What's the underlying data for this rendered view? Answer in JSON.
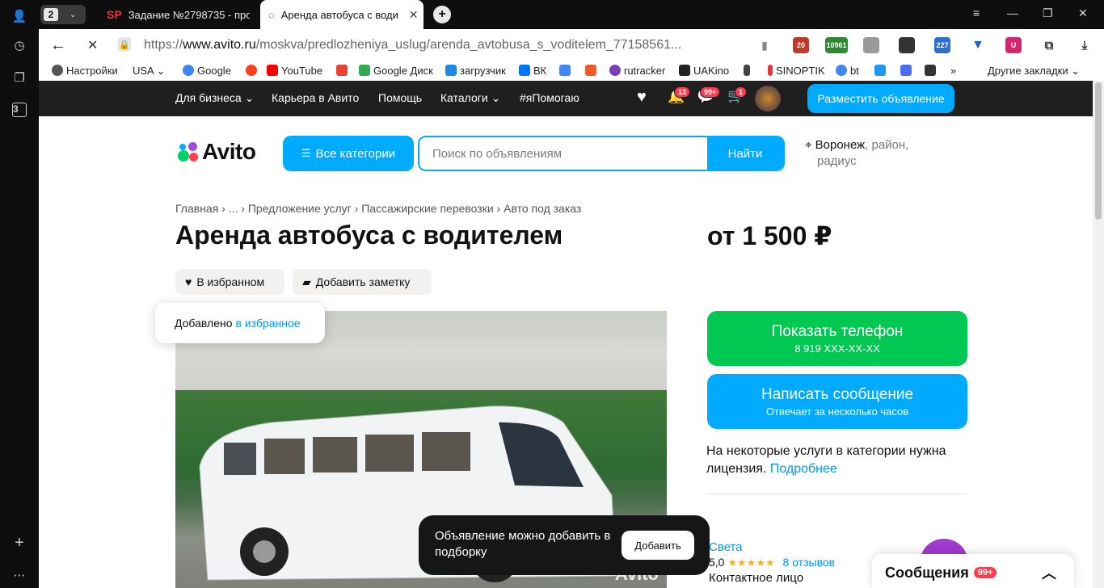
{
  "browser": {
    "tab_count": "2",
    "tabs": [
      {
        "label": "Задание №2798735 - про",
        "favicon": "SP"
      },
      {
        "label": "Аренда автобуса с води"
      }
    ],
    "url_prefix": "https://",
    "url_domain": "www.avito.ru",
    "url_path": "/moskva/predlozheniya_uslug/arenda_avtobusa_s_voditelem_77158561...",
    "extensions": [
      "20",
      "10961",
      "227"
    ],
    "bookmarks": [
      "Настройки",
      "USA",
      "Google",
      "YouTube",
      "Google Диск",
      "загрузчик",
      "ВК",
      "rutracker",
      "UAKino",
      "SINOPTIK",
      "bt",
      "Другие закладки"
    ],
    "sidebar_badge": "3"
  },
  "topnav": {
    "items": [
      "Для бизнеса",
      "Карьера в Авито",
      "Помощь",
      "Каталоги",
      "#яПомогаю"
    ],
    "notif_badge": "13",
    "msg_badge": "99+",
    "cart_badge": "1",
    "post_label": "Разместить объявление"
  },
  "header": {
    "logo": "Avito",
    "all_categories": "Все категории",
    "search_placeholder": "Поиск по объявлениям",
    "search_button": "Найти",
    "location_city": "Воронеж",
    "location_rest": ", район,",
    "location_line2": "радиус"
  },
  "breadcrumbs": "Главная  ›  ...  ›  Предложение услуг  ›  Пассажирские перевозки  ›  Авто под заказ",
  "listing": {
    "title": "Аренда автобуса с водителем",
    "price": "от 1 500 ₽",
    "fav_label": "В избранном",
    "note_label": "Добавить заметку",
    "toast_prefix": "Добавлено",
    "toast_link": "в избранное",
    "watermark": "Avito"
  },
  "actions": {
    "phone_label": "Показать телефон",
    "phone_number": "8 919 XXX-XX-XX",
    "msg_label": "Написать сообщение",
    "msg_sub": "Отвечает за несколько часов",
    "license_text": "На некоторые услуги в категории нужна лицензия.",
    "license_link": "Подробнее"
  },
  "seller": {
    "name": "Света",
    "rating": "5,0",
    "stars": "★★★★★",
    "reviews": "8 отзывов",
    "role": "Контактное лицо"
  },
  "snackbar": {
    "text": "Объявление можно добавить в подборку",
    "button": "Добавить"
  },
  "messenger": {
    "label": "Сообщения",
    "count": "99+"
  },
  "colors": {
    "accent": "#00aaff",
    "green": "#00c853",
    "dark": "#1f1f1f",
    "badge": "#ff3b4f"
  }
}
